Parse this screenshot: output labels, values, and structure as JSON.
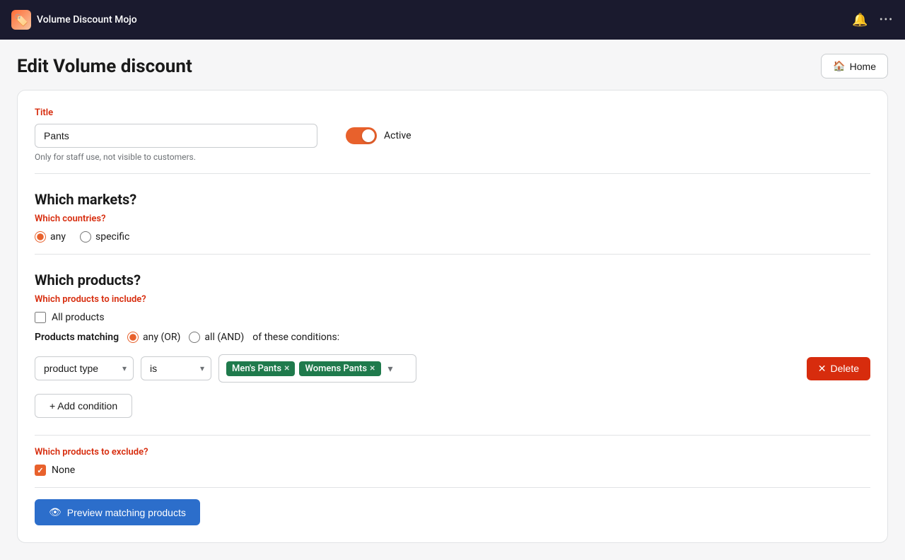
{
  "app": {
    "name": "Volume Discount Mojo",
    "icon": "🏷️"
  },
  "topbar": {
    "bell_icon": "🔔",
    "more_icon": "···"
  },
  "page": {
    "title": "Edit Volume discount",
    "home_button": "Home"
  },
  "form": {
    "title_label": "Title",
    "title_value": "Pants",
    "title_helper": "Only for staff use, not visible to customers.",
    "active_label": "Active",
    "active": true
  },
  "markets": {
    "heading": "Which markets?",
    "countries_label": "Which countries?",
    "any_label": "any",
    "specific_label": "specific",
    "selected": "any"
  },
  "products": {
    "heading": "Which products?",
    "include_label": "Which products to include?",
    "all_products_label": "All products",
    "matching_label": "Products matching",
    "any_or_label": "any (OR)",
    "all_and_label": "all (AND)",
    "conditions_label": "of these conditions:",
    "condition": {
      "field": "product type",
      "operator": "is",
      "tags": [
        "Men's Pants",
        "Womens Pants"
      ]
    },
    "add_condition_label": "+ Add condition",
    "delete_label": "✕ Delete"
  },
  "exclude": {
    "label": "Which products to exclude?",
    "none_label": "None"
  },
  "preview": {
    "label": "Preview matching products",
    "icon": "👁"
  }
}
